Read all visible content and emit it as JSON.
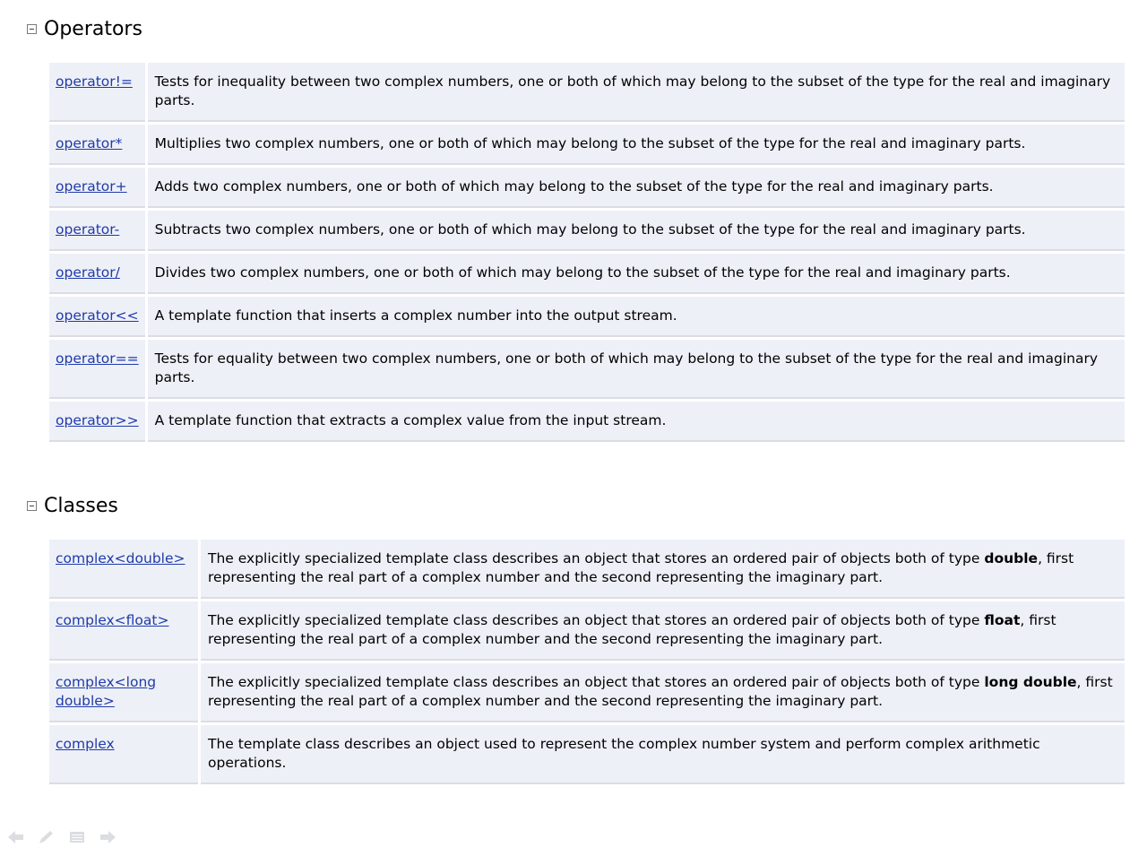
{
  "operators": {
    "title": "Operators",
    "rows": [
      {
        "name": "operator!=",
        "desc": "Tests for inequality between two complex numbers, one or both of which may belong to the subset of the type for the real and imaginary parts."
      },
      {
        "name": "operator*",
        "desc": "Multiplies two complex numbers, one or both of which may belong to the subset of the type for the real and imaginary parts."
      },
      {
        "name": "operator+",
        "desc": "Adds two complex numbers, one or both of which may belong to the subset of the type for the real and imaginary parts."
      },
      {
        "name": "operator-",
        "desc": "Subtracts two complex numbers, one or both of which may belong to the subset of the type for the real and imaginary parts."
      },
      {
        "name": "operator/",
        "desc": "Divides two complex numbers, one or both of which may belong to the subset of the type for the real and imaginary parts."
      },
      {
        "name": "operator<<",
        "desc": "A template function that inserts a complex number into the output stream."
      },
      {
        "name": "operator==",
        "desc": "Tests for equality between two complex numbers, one or both of which may belong to the subset of the type for the real and imaginary parts."
      },
      {
        "name": "operator>>",
        "desc": "A template function that extracts a complex value from the input stream."
      }
    ]
  },
  "classes": {
    "title": "Classes",
    "rows": [
      {
        "name": "complex<double>",
        "desc_pre": "The explicitly specialized template class describes an object that stores an ordered pair of objects both of type ",
        "desc_bold": "double",
        "desc_post": ", first representing the real part of a complex number and the second representing the imaginary part."
      },
      {
        "name": "complex<float>",
        "desc_pre": "The explicitly specialized template class describes an object that stores an ordered pair of objects both of type ",
        "desc_bold": "float",
        "desc_post": ", first representing the real part of a complex number and the second representing the imaginary part."
      },
      {
        "name": "complex<long double>",
        "desc_pre": "The explicitly specialized template class describes an object that stores an ordered pair of objects both of type ",
        "desc_bold": "long double",
        "desc_post": ", first representing the real part of a complex number and the second representing the imaginary part."
      },
      {
        "name": "complex",
        "desc_pre": "The template class describes an object used to represent the complex number system and perform complex arithmetic operations.",
        "desc_bold": "",
        "desc_post": ""
      }
    ]
  },
  "nav": {
    "icons": [
      "arrow-left-icon",
      "pen-icon",
      "menu-icon",
      "arrow-right-icon"
    ]
  }
}
